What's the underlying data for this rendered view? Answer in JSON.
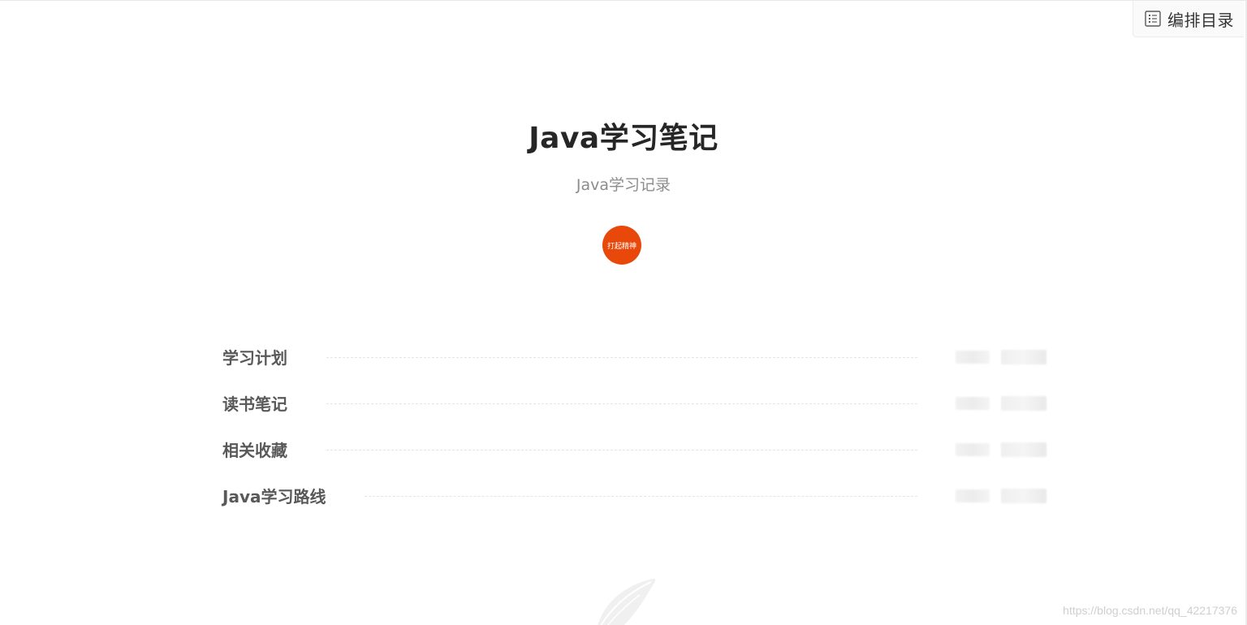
{
  "toolbar": {
    "toc_label": "编排目录",
    "toc_icon": "list-icon"
  },
  "book": {
    "title": "Java学习笔记",
    "subtitle": "Java学习记录",
    "avatar_text": "打起精神",
    "avatar_color": "#e8490b"
  },
  "toc": {
    "items": [
      {
        "title": "学习计划"
      },
      {
        "title": "读书笔记"
      },
      {
        "title": "相关收藏"
      },
      {
        "title": "Java学习路线"
      }
    ]
  },
  "footer": {
    "decoration_icon": "feather-icon",
    "watermark": "https://blog.csdn.net/qq_42217376"
  }
}
